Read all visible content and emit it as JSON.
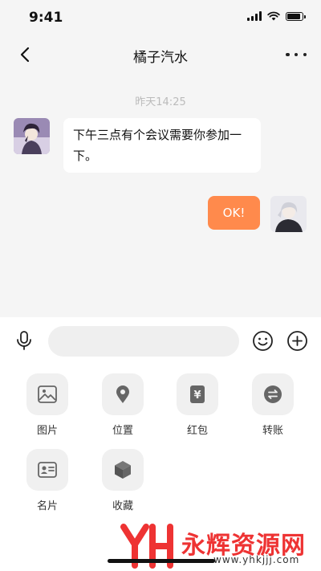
{
  "status_bar": {
    "time": "9:41"
  },
  "nav": {
    "title": "橘子汽水"
  },
  "chat": {
    "timestamp": "昨天14:25",
    "messages": [
      {
        "side": "left",
        "text": "下午三点有个会议需要你参加一下。"
      },
      {
        "side": "right",
        "text": "OK!"
      }
    ]
  },
  "input": {
    "placeholder": "",
    "value": ""
  },
  "tools": [
    {
      "label": "图片",
      "icon": "image-icon"
    },
    {
      "label": "位置",
      "icon": "location-icon"
    },
    {
      "label": "红包",
      "icon": "red-packet-icon"
    },
    {
      "label": "转账",
      "icon": "transfer-icon"
    },
    {
      "label": "名片",
      "icon": "contact-card-icon"
    },
    {
      "label": "收藏",
      "icon": "favorites-icon"
    }
  ],
  "watermark": {
    "brand": "永辉资源网",
    "url": "www.yhkjjj.com"
  },
  "colors": {
    "accent": "#ff8a4c",
    "background": "#f5f5f5",
    "watermark": "#ee3333"
  }
}
